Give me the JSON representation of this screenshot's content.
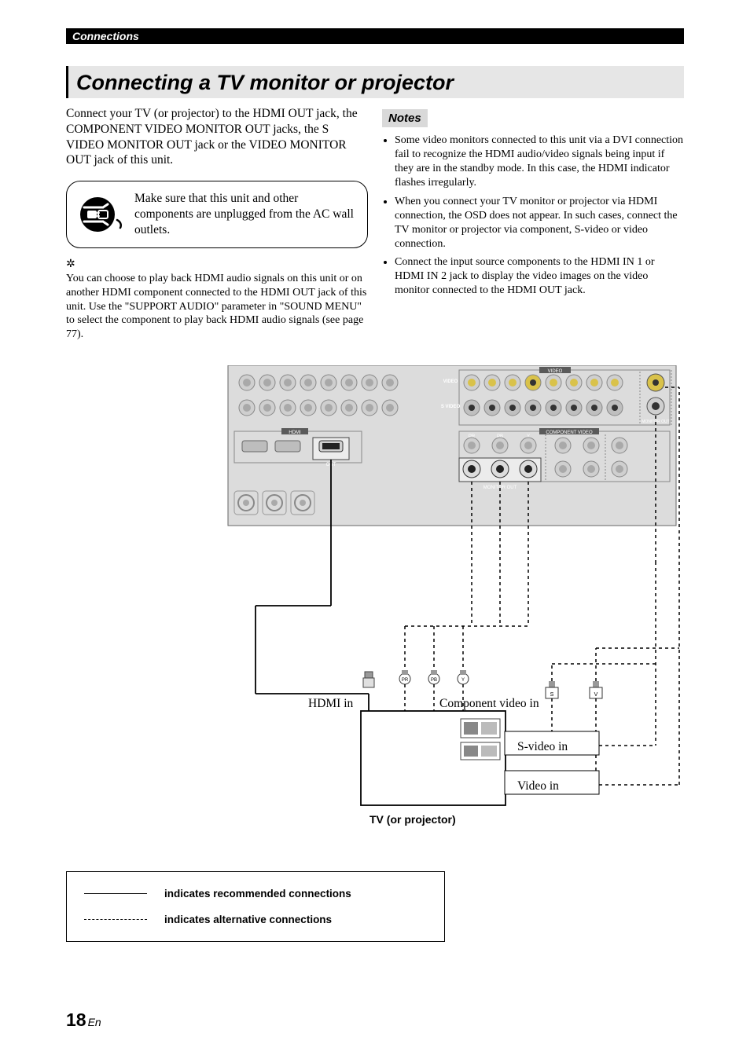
{
  "header": {
    "breadcrumb": "Connections"
  },
  "section": {
    "title": "Connecting a TV monitor or projector"
  },
  "left": {
    "intro": "Connect your TV (or projector) to the HDMI OUT jack, the COMPONENT VIDEO MONITOR OUT jacks, the S VIDEO MONITOR OUT jack or the VIDEO MONITOR OUT jack of this unit.",
    "caution": "Make sure that this unit and other components are unplugged from the AC wall outlets.",
    "hint_icon": "✲",
    "hint": "You can choose to play back HDMI audio signals on this unit or on another HDMI component connected to the HDMI OUT jack of this unit. Use the \"SUPPORT AUDIO\" parameter in \"SOUND MENU\" to select the component to play back HDMI audio signals (see page 77)."
  },
  "right": {
    "notes_label": "Notes",
    "notes": [
      "Some video monitors connected to this unit via a DVI connection fail to recognize the HDMI audio/video signals being input if they are in the standby mode. In this case, the HDMI indicator flashes irregularly.",
      "When you connect your TV monitor or projector via HDMI connection, the OSD does not appear. In such cases, connect the TV monitor or projector via component, S-video or video connection.",
      "Connect the input source components to the HDMI IN 1 or HDMI IN 2 jack to display the video images on the video monitor connected to the HDMI OUT jack."
    ]
  },
  "diagram": {
    "panel_labels": {
      "video_group": "VIDEO",
      "video_row": "VIDEO",
      "svideo_row": "S VIDEO",
      "hdmi": "HDMI",
      "hdmi_out": "OUT",
      "component": "COMPONENT VIDEO",
      "pr": "PR",
      "pb": "PB",
      "y": "Y",
      "monitor_out": "MONITOR OUT"
    },
    "cables": {
      "hdmi_in": "HDMI in",
      "component_in": "Component video in",
      "svideo_in": "S-video in",
      "video_in": "Video in",
      "comp_pr": "PR",
      "comp_pb": "PB",
      "comp_y": "Y",
      "svid_s": "S",
      "vid_v": "V"
    },
    "tv_caption": "TV (or projector)"
  },
  "legend": {
    "recommended": "indicates recommended connections",
    "alternative": "indicates alternative connections"
  },
  "footer": {
    "page": "18",
    "lang": "En"
  }
}
